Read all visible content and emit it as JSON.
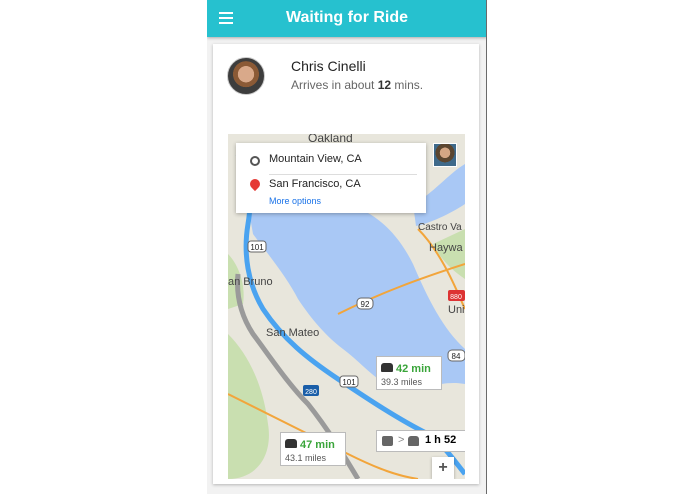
{
  "app_bar": {
    "title": "Waiting for Ride"
  },
  "driver": {
    "name": "Chris Cinelli",
    "eta_prefix": "Arrives in about",
    "eta_minutes": "12",
    "eta_suffix": "mins."
  },
  "map": {
    "directions": {
      "origin": "Mountain View, CA",
      "destination": "San Francisco, CA",
      "more_options": "More options"
    },
    "place_labels": {
      "oakland": "Oakland",
      "castro_valley": "Castro Va",
      "hayward": "Haywa",
      "san_bruno": "an Bruno",
      "san_mateo": "San Mateo",
      "union_city": "Uni"
    },
    "road_shields": {
      "hwy101_top": "101",
      "hwy92": "92",
      "hwy880": "880",
      "hwy84": "84",
      "hwy280": "280",
      "hwy101_mid": "101",
      "hwy280_bottom": "280"
    },
    "route_primary": {
      "time": "42 min",
      "distance": "39.3 miles"
    },
    "route_alternate": {
      "time": "47 min",
      "distance": "43.1 miles"
    },
    "transit": {
      "separator": ">",
      "time": "1 h 52"
    },
    "zoom_in_label": "+",
    "colors": {
      "water": "#a9c8f5",
      "land": "#e8e6dc",
      "route_primary": "#4aa3f0",
      "route_alt": "#9a9a9a",
      "highway": "#f2a53b"
    }
  }
}
